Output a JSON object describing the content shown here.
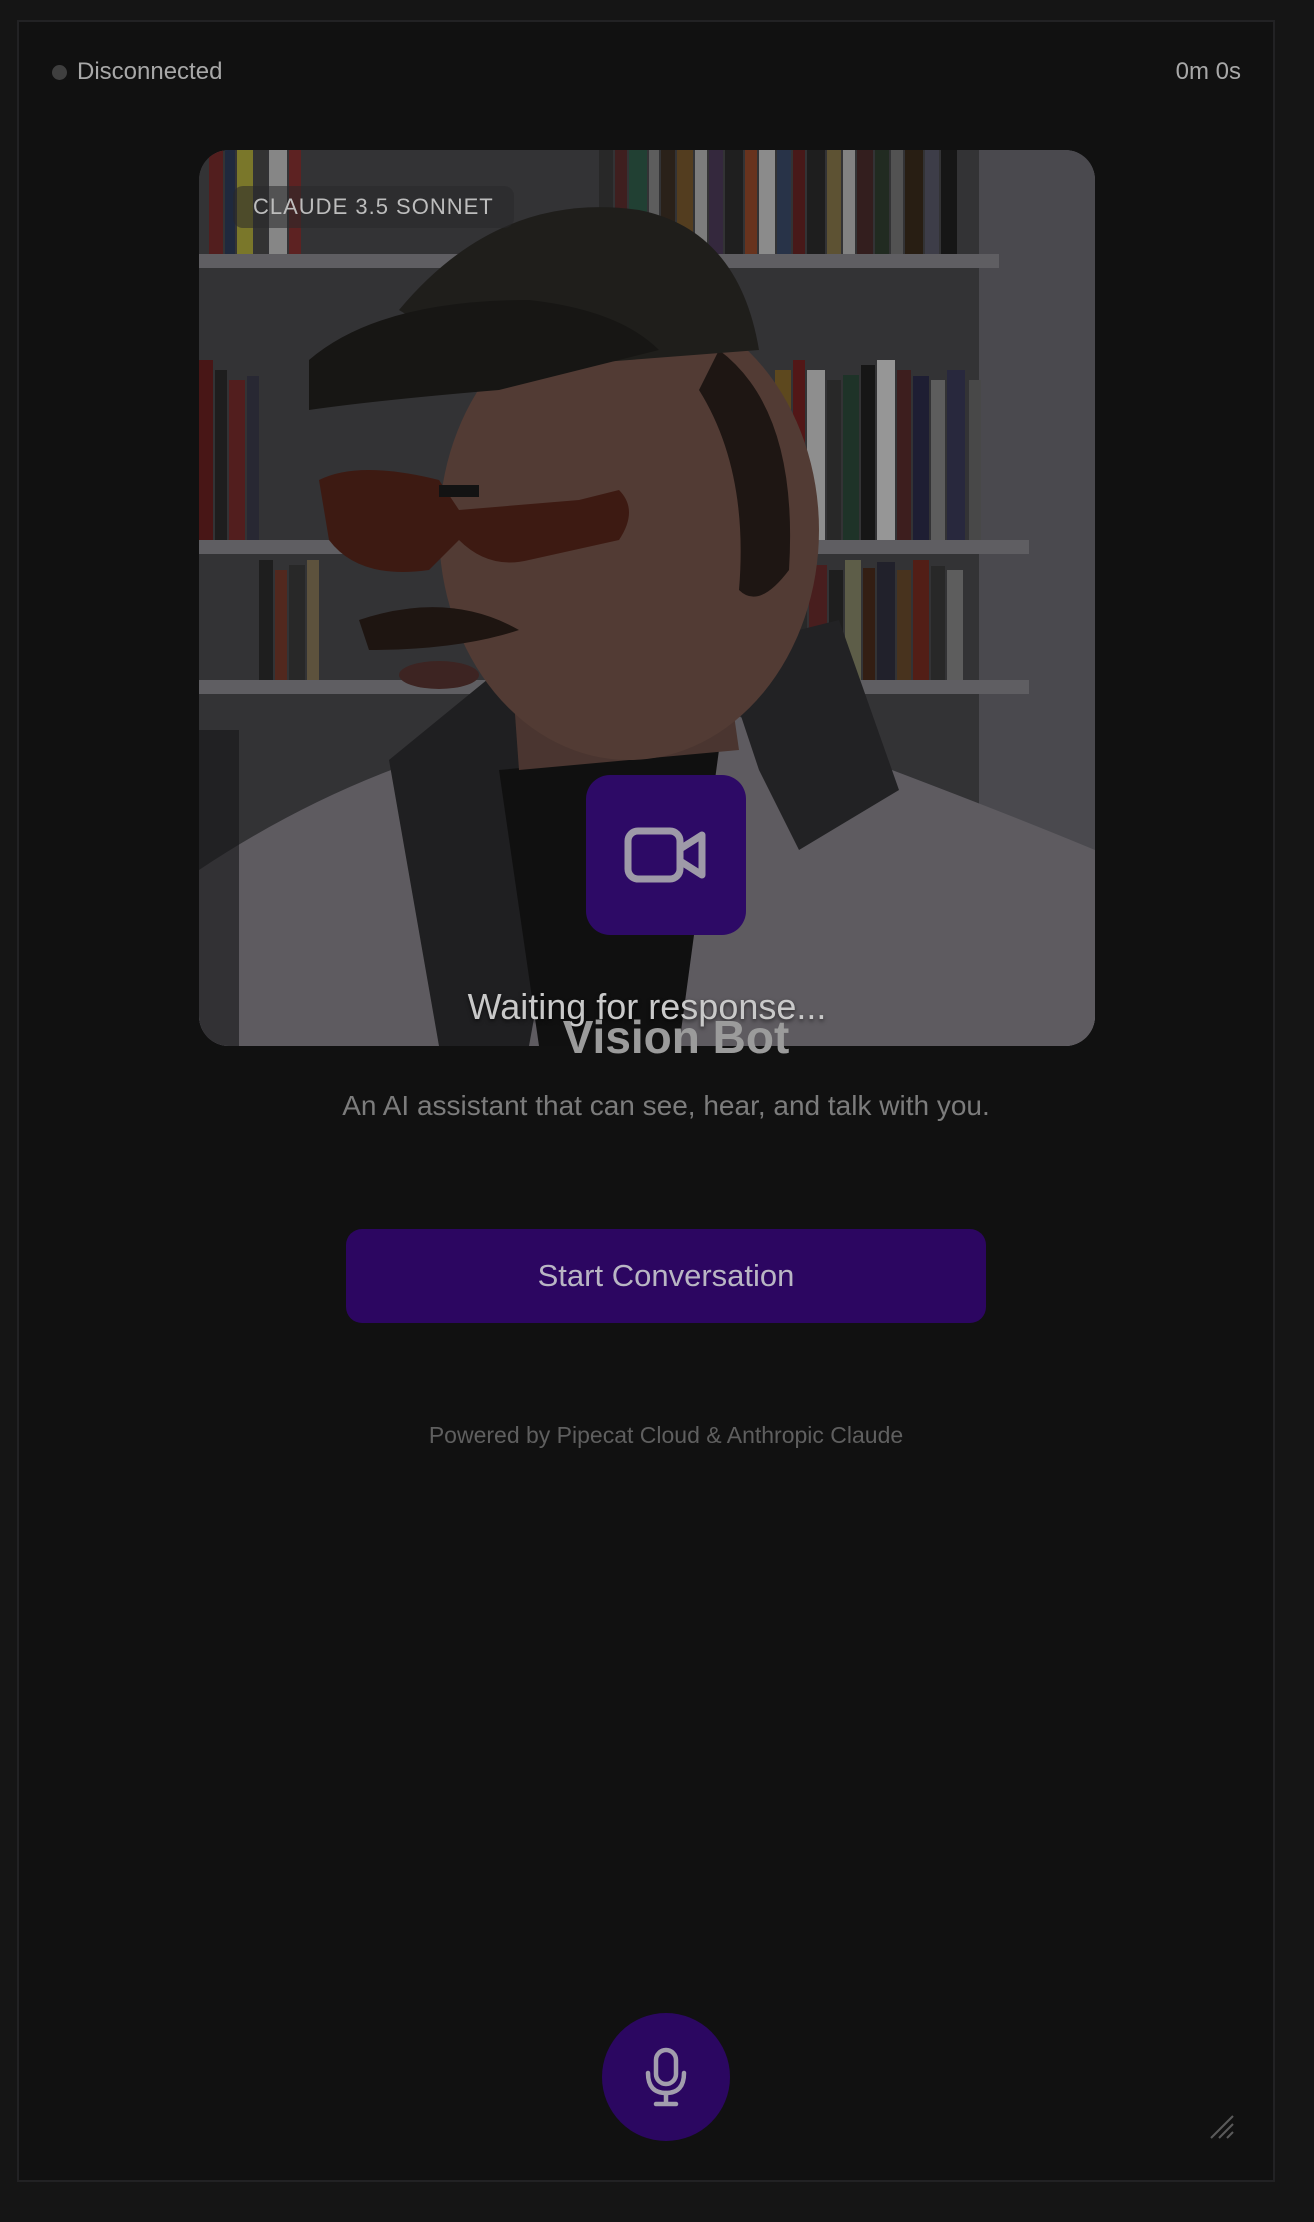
{
  "status": {
    "text": "Disconnected",
    "dot_color": "#3f3f3f"
  },
  "timer": "0m 0s",
  "video": {
    "model_badge": "CLAUDE 3.5 SONNET",
    "waiting_text": "Waiting for response...",
    "camera_icon": "video-camera-icon"
  },
  "bot": {
    "title": "Vision Bot",
    "description": "An AI assistant that can see, hear, and talk with you."
  },
  "start_button": {
    "label": "Start Conversation",
    "color": "#2c0661"
  },
  "footer": {
    "powered_by": "Powered by Pipecat Cloud & Anthropic Claude"
  },
  "mic_button": {
    "icon": "microphone-icon",
    "color": "#2b0761"
  },
  "colors": {
    "background": "#111111",
    "accent": "#2d0a66"
  }
}
